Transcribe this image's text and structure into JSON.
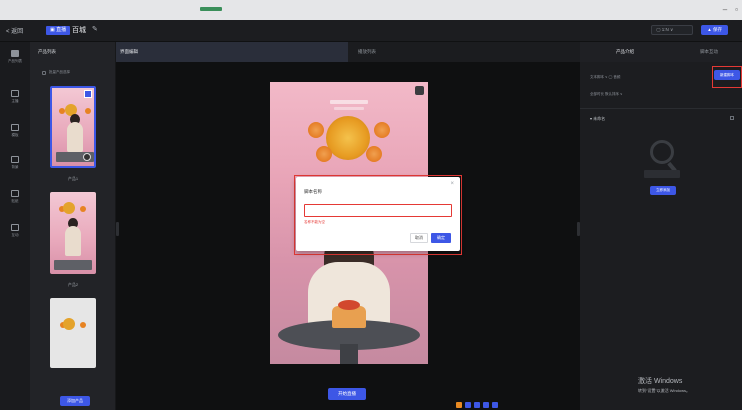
{
  "toolbar": {
    "back_label": "< 返回",
    "tag_label": "▣ 直播",
    "project_name": "百城",
    "select_label": "▢ 1:N ∨",
    "export_label": "▲ 保存"
  },
  "rail": {
    "items": [
      "产品列表",
      "主播",
      "模板",
      "背景",
      "贴纸",
      "互动"
    ]
  },
  "product_panel": {
    "title": "产品列表",
    "select_all_label": "批量产品选择",
    "thumb1_label": "产品1",
    "thumb2_label": "产品2",
    "add_button": "添加产品"
  },
  "main": {
    "tab1": "界面编辑",
    "tab2": "播放列表",
    "start_live_button": "开始直播"
  },
  "dialog": {
    "title": "脚本名称",
    "input_value": "",
    "error_text": "名称不能为空",
    "cancel_label": "取消",
    "ok_label": "确定",
    "close_icon": "×"
  },
  "right_panel": {
    "tab1": "产品介绍",
    "tab2": "脚本互动",
    "filter_label": "文本脚本 ∨   ◯ 音频",
    "sort_label": "全部时长   默认排序 ∨",
    "new_script_button": "新建脚本",
    "section_label": "▾ 未命名",
    "add_button": "立即添加"
  },
  "watermark": {
    "line1": "激活 Windows",
    "line2": "转到“设置”以激活 Windows。"
  },
  "colors": {
    "accent": "#3d57e6",
    "error": "#e53935"
  }
}
